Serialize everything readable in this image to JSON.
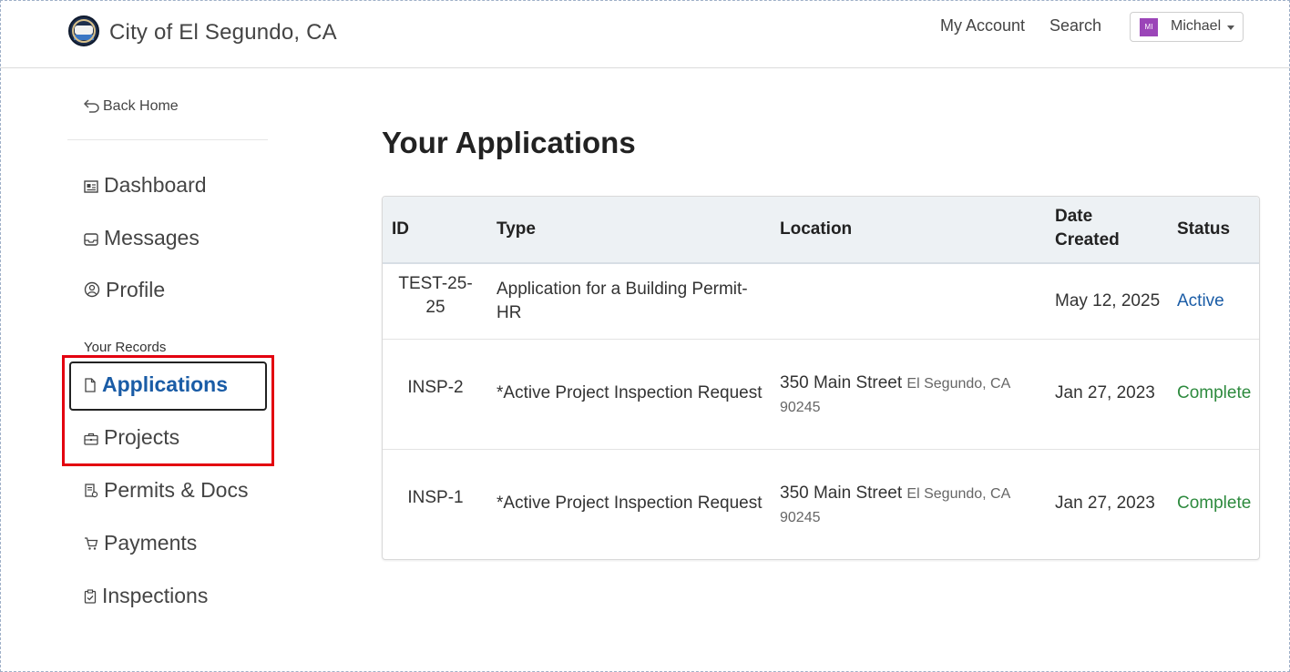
{
  "header": {
    "brand": "City of El Segundo, CA",
    "nav": {
      "my_account": "My Account",
      "search": "Search"
    },
    "user": {
      "initials": "MI",
      "name": "Michael"
    }
  },
  "sidebar": {
    "back_home": "Back Home",
    "items": [
      {
        "label": "Dashboard",
        "icon": "dashboard-icon"
      },
      {
        "label": "Messages",
        "icon": "inbox-icon"
      },
      {
        "label": "Profile",
        "icon": "user-circle-icon"
      }
    ],
    "records_label": "Your Records",
    "records": [
      {
        "label": "Applications",
        "icon": "file-icon",
        "active": true
      },
      {
        "label": "Projects",
        "icon": "briefcase-icon"
      },
      {
        "label": "Permits & Docs",
        "icon": "document-icon"
      },
      {
        "label": "Payments",
        "icon": "cart-icon"
      },
      {
        "label": "Inspections",
        "icon": "clipboard-check-icon"
      }
    ]
  },
  "main": {
    "title": "Your Applications",
    "table": {
      "headers": {
        "id": "ID",
        "type": "Type",
        "location": "Location",
        "date_line1": "Date",
        "date_line2": "Created",
        "status": "Status"
      },
      "rows": [
        {
          "id_line1": "TEST-25-",
          "id_line2": "25",
          "type_line1": "Application for a Building Permit-",
          "type_line2": "HR",
          "street": "",
          "city": "",
          "zip": "",
          "date": "May 12, 2025",
          "status": "Active"
        },
        {
          "id": "INSP-2",
          "type": "*Active Project Inspection Request",
          "street": "350 Main Street",
          "city": "El Segundo, CA",
          "zip": "90245",
          "date": "Jan 27, 2023",
          "status": "Complete"
        },
        {
          "id": "INSP-1",
          "type": "*Active Project Inspection Request",
          "street": "350 Main Street",
          "city": "El Segundo, CA",
          "zip": "90245",
          "date": "Jan 27, 2023",
          "status": "Complete"
        }
      ]
    }
  },
  "colors": {
    "link_blue": "#1a5ca6",
    "complete_green": "#2d8a3e",
    "highlight_red": "#e3000f",
    "avatar_purple": "#9b45b8"
  }
}
